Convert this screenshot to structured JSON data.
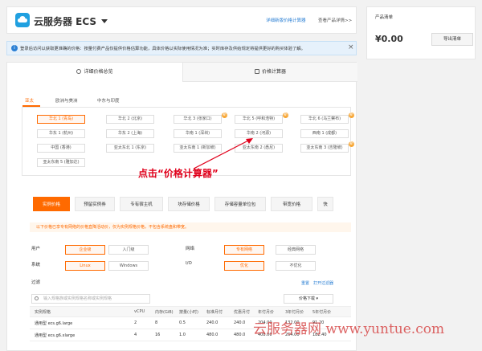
{
  "header": {
    "title": "云服务器 ECS",
    "link_calculator": "详细新版价格计算器",
    "link_details": "查看产品详情>>"
  },
  "product_list": {
    "title": "产品清单",
    "total": "¥0.00",
    "export_label": "导出清单"
  },
  "notice": {
    "text": "登录后访问以获取更准确的价格：按量付费产品仅提供价格估算功能，具体价格以实际使用情况为准；实时库存及供给规定将提供更好的购买体验了解。"
  },
  "tabs": [
    {
      "label": "详细价格总览"
    },
    {
      "label": "价格计算器"
    }
  ],
  "region_tabs": [
    {
      "label": "亚太"
    },
    {
      "label": "欧洲与美洲"
    },
    {
      "label": "中东与印度"
    }
  ],
  "regions": [
    {
      "label": "华北 1 (青岛)",
      "selected": true
    },
    {
      "label": "华北 2 (北京)"
    },
    {
      "label": "华北 3 (张家口)",
      "badge": "新"
    },
    {
      "label": "华北 5 (呼和浩特)",
      "badge": "新"
    },
    {
      "label": "华北 6 (乌兰察布)",
      "badge": "新"
    },
    {
      "label": "华东 1 (杭州)"
    },
    {
      "label": "华东 2 (上海)"
    },
    {
      "label": "华南 1 (深圳)"
    },
    {
      "label": "华南 2 (河源)"
    },
    {
      "label": "西南 1 (成都)"
    },
    {
      "label": "中国 (香港)"
    },
    {
      "label": "亚太东北 1 (东京)"
    },
    {
      "label": "亚太东南 1 (新加坡)"
    },
    {
      "label": "亚太东南 2 (悉尼)"
    },
    {
      "label": "亚太东南 3 (吉隆坡)",
      "badge": "新"
    },
    {
      "label": "亚太东南 5 (雅加达)"
    }
  ],
  "annotation": "点击“价格计算器”",
  "product_tabs": [
    {
      "label": "实例价格",
      "selected": true
    },
    {
      "label": "预留实例券"
    },
    {
      "label": "专有宿主机"
    },
    {
      "label": "块存储价格"
    },
    {
      "label": "存储容量单位包"
    },
    {
      "label": "带宽价格"
    },
    {
      "label": "快"
    }
  ],
  "sub_hint": "以下价格已享专有网络的价格直降活动价，仅为实例规格价格，不包含系统盘和带宽。",
  "filters": {
    "user_label": "用户",
    "user_options": [
      {
        "label": "企业级",
        "selected": true
      },
      {
        "label": "入门级"
      }
    ],
    "network_label": "网络",
    "network_options": [
      {
        "label": "专有网络",
        "selected": true
      },
      {
        "label": "经典网络"
      }
    ],
    "os_label": "系统",
    "os_options": [
      {
        "label": "Linux",
        "selected": true
      },
      {
        "label": "Windows"
      }
    ],
    "io_label": "I/O",
    "io_options": [
      {
        "label": "优化",
        "selected": true
      },
      {
        "label": "不优化"
      }
    ],
    "filter_label": "过滤",
    "reset_label": "重置",
    "open_filter_label": "打开过滤器"
  },
  "search": {
    "placeholder": "输入规格族或实例规格名称或实例规格"
  },
  "price_dropdown": "价格下载",
  "table": {
    "headers": [
      "实例规格",
      "vCPU",
      "内存(GiB)",
      "按量(小时)",
      "标准月付",
      "优惠月付",
      "年付月价",
      "3年付月价",
      "5年付月价"
    ],
    "rows": [
      [
        "通用型 ecs.g6.large",
        "2",
        "8",
        "0.5",
        "240.0",
        "240.0",
        "204.00",
        "132.00",
        "91.20"
      ],
      [
        "通用型 ecs.g6.xlarge",
        "4",
        "16",
        "1.0",
        "480.0",
        "480.0",
        "408.00",
        "264.00",
        "182.40"
      ]
    ]
  },
  "watermark": "云服务器网 www.yuntue.com",
  "colors": {
    "accent": "#ff6a00",
    "link": "#2a7fd4",
    "annotation": "#e0001b"
  }
}
